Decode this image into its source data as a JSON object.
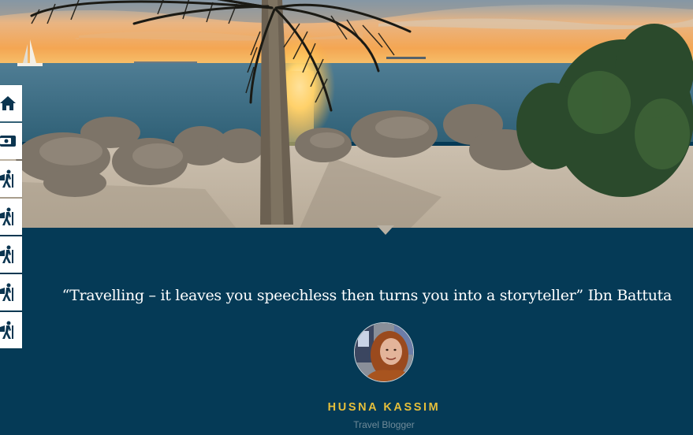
{
  "sidebar": {
    "items": [
      {
        "icon": "home-icon"
      },
      {
        "icon": "id-card-icon"
      },
      {
        "icon": "hiker-icon"
      },
      {
        "icon": "hiker-icon"
      },
      {
        "icon": "hiker-icon"
      },
      {
        "icon": "hiker-icon"
      },
      {
        "icon": "hiker-icon"
      }
    ],
    "icon_color": "#0b3550"
  },
  "testimonial": {
    "quote": "“Travelling – it leaves you speechless then turns you into a storyteller” Ibn Battuta",
    "author_name": "HUSNA KASSIM",
    "author_role": "Travel Blogger"
  },
  "colors": {
    "panel_bg": "#053a56",
    "author_name": "#e6bf3b",
    "author_role": "#6f8a98"
  }
}
